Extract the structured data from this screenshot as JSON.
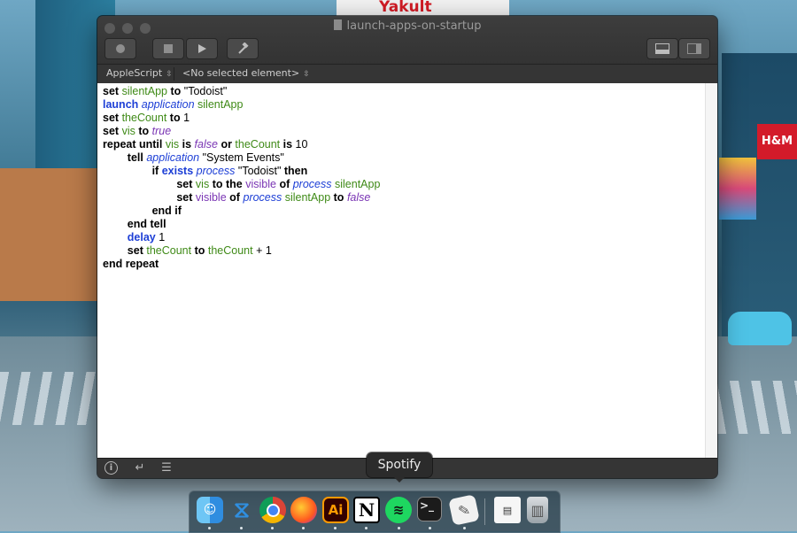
{
  "window": {
    "title": "launch-apps-on-startup",
    "toolbar": {
      "record_icon": "record-icon",
      "stop_icon": "stop-icon",
      "run_icon": "run-icon",
      "compile_icon": "hammer-icon"
    }
  },
  "navbar": {
    "language": "AppleScript",
    "element": "<No selected element>"
  },
  "code_lines": [
    "set silentApp to \"Todoist\"",
    "launch application silentApp",
    "set theCount to 1",
    "set vis to true",
    "repeat until vis is false or theCount is 10",
    "tell application \"System Events\"",
    "if exists process \"Todoist\" then",
    "set vis to the visible of process silentApp",
    "set visible of process silentApp to false",
    "end if",
    "end tell",
    "delay 1",
    "set theCount to theCount + 1",
    "end repeat"
  ],
  "background_signs": {
    "yakult": "Yakult",
    "hm": "H&M"
  },
  "tooltip": "Spotify",
  "bottombar": {
    "info_icon": "info-icon",
    "return_icon": "return-icon",
    "list_icon": "list-icon"
  },
  "dock": {
    "apps": [
      "Finder",
      "Visual Studio Code",
      "Google Chrome",
      "Firefox",
      "Adobe Illustrator",
      "Notion",
      "Spotify",
      "Terminal",
      "Script Editor",
      "Document",
      "Trash"
    ],
    "glyphs": {
      "ai": "Ai",
      "notion": "N",
      "terminal": ">_"
    }
  },
  "colors": {
    "keyword": "#000000",
    "application_keyword": "#1d3fd6",
    "variable": "#3f8a17",
    "class": "#1d3fd6",
    "property": "#7a35b4",
    "window_chrome": "#2b2b2b"
  }
}
